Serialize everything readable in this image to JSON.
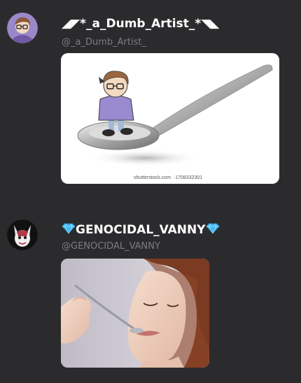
{
  "posts": [
    {
      "author_name": "◢◤*_a_Dumb_Artist_*◥◣",
      "handle": "@_a_Dumb_Artist_",
      "avatar_icon": "cartoon-character-avatar",
      "media": {
        "description_icon": "cartoon-character-on-spoon-image",
        "watermark": "shutterstock.com · 1708332301"
      }
    },
    {
      "author_name": "GENOCIDAL_VANNY",
      "name_decoration_icon": "gem-emoji",
      "handle": "@GENOCIDAL_VANNY",
      "avatar_icon": "vanny-mask-avatar",
      "media": {
        "description_icon": "woman-tasting-from-spoon-image"
      }
    }
  ],
  "colors": {
    "background": "#2b2b2d",
    "name_text": "#ffffff",
    "handle_text": "#7b7d83",
    "gem": "#3fb8f0"
  }
}
